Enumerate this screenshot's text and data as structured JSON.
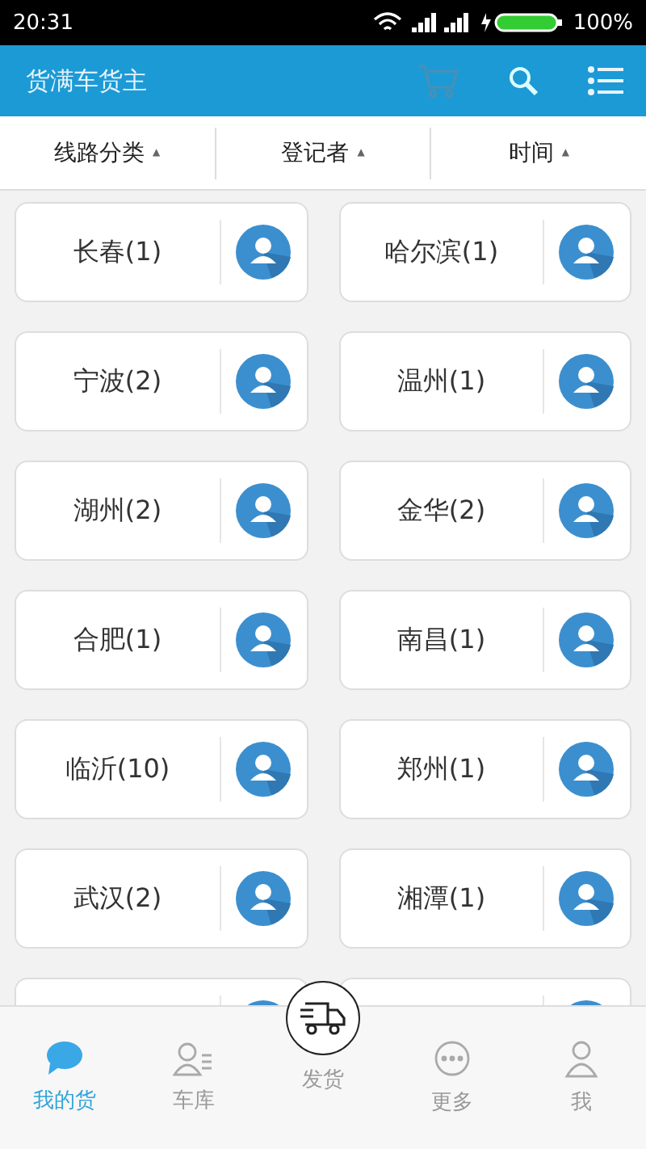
{
  "status_bar": {
    "time": "20:31",
    "battery": "100%"
  },
  "app_bar": {
    "title": "货满车货主"
  },
  "filters": [
    {
      "label": "线路分类",
      "symbol": "▲"
    },
    {
      "label": "登记者",
      "symbol": "▲"
    },
    {
      "label": "时间",
      "symbol": "▲"
    }
  ],
  "routes": [
    {
      "label": "长春(1)"
    },
    {
      "label": "哈尔滨(1)"
    },
    {
      "label": "宁波(2)"
    },
    {
      "label": "温州(1)"
    },
    {
      "label": "湖州(2)"
    },
    {
      "label": "金华(2)"
    },
    {
      "label": "合肥(1)"
    },
    {
      "label": "南昌(1)"
    },
    {
      "label": "临沂(10)"
    },
    {
      "label": "郑州(1)"
    },
    {
      "label": "武汉(2)"
    },
    {
      "label": "湘潭(1)"
    }
  ],
  "tab_bar": [
    {
      "label": "我的货",
      "kind": "chat",
      "selected": true
    },
    {
      "label": "车库",
      "kind": "contacts",
      "selected": false
    },
    {
      "label": "发货",
      "kind": "truck",
      "selected": false
    },
    {
      "label": "更多",
      "kind": "more",
      "selected": false
    },
    {
      "label": "我",
      "kind": "person",
      "selected": false
    }
  ]
}
